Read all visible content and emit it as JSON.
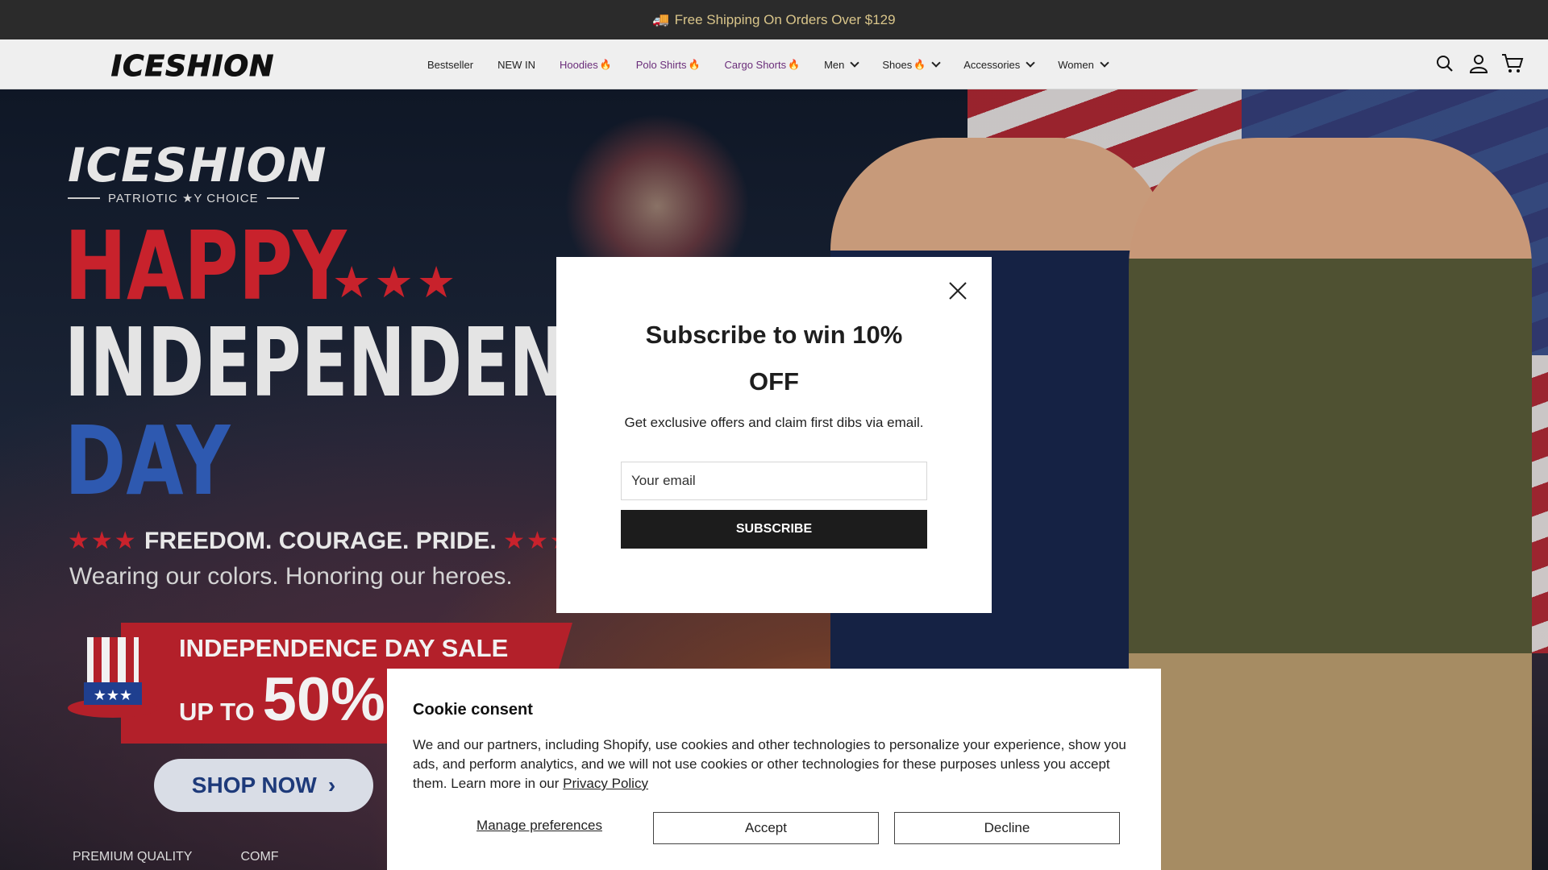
{
  "announcement": {
    "icon": "truck-icon",
    "text": "Free Shipping On Orders Over $129"
  },
  "header": {
    "logo": "ICESHION",
    "nav": [
      {
        "label": "Bestseller",
        "style": "plain",
        "fire": false,
        "dropdown": false
      },
      {
        "label": "NEW IN",
        "style": "plain",
        "fire": false,
        "dropdown": false
      },
      {
        "label": "Hoodies",
        "style": "purple",
        "fire": true,
        "dropdown": false
      },
      {
        "label": "Polo Shirts",
        "style": "purple",
        "fire": true,
        "dropdown": false
      },
      {
        "label": "Cargo Shorts",
        "style": "purple",
        "fire": true,
        "dropdown": false
      },
      {
        "label": "Men",
        "style": "plain",
        "fire": false,
        "dropdown": true
      },
      {
        "label": "Shoes",
        "style": "plain",
        "fire": true,
        "dropdown": true
      },
      {
        "label": "Accessories",
        "style": "plain",
        "fire": false,
        "dropdown": true
      },
      {
        "label": "Women",
        "style": "plain",
        "fire": false,
        "dropdown": true
      }
    ],
    "icons": [
      "search-icon",
      "account-icon",
      "cart-icon"
    ]
  },
  "hero": {
    "brand": "ICESHION",
    "tagline": "PATRIOTIC ★Y CHOICE",
    "line1": "HAPPY",
    "line2": "INDEPENDENCE",
    "line3": "DAY",
    "stars": "★★★",
    "motto": "FREEDOM. COURAGE. PRIDE.",
    "subtitle": "Wearing our colors. Honoring our heroes.",
    "sale_title": "INDEPENDENCE DAY SALE",
    "sale_prefix": "UP TO",
    "sale_percent": "50%",
    "shop_button": "SHOP NOW",
    "badges": [
      "PREMIUM QUALITY",
      "COMF"
    ]
  },
  "modal": {
    "title": "Subscribe to win 10% OFF",
    "description": "Get exclusive offers and claim first dibs via email.",
    "email_placeholder": "Your email",
    "button": "SUBSCRIBE"
  },
  "cookie": {
    "title": "Cookie consent",
    "text": "We and our partners, including Shopify, use cookies and other technologies to personalize your experience, show you ads, and perform analytics, and we will not use cookies or other technologies for these purposes unless you accept them. Learn more in our",
    "link": "Privacy Policy",
    "manage": "Manage preferences",
    "accept": "Accept",
    "decline": "Decline"
  },
  "colors": {
    "announcement_bg": "#2b2b2b",
    "announcement_text": "#d9c58a",
    "nav_highlight": "#6a2d7a",
    "sale_red": "#b3202a",
    "button_dark": "#1c1c1c"
  }
}
